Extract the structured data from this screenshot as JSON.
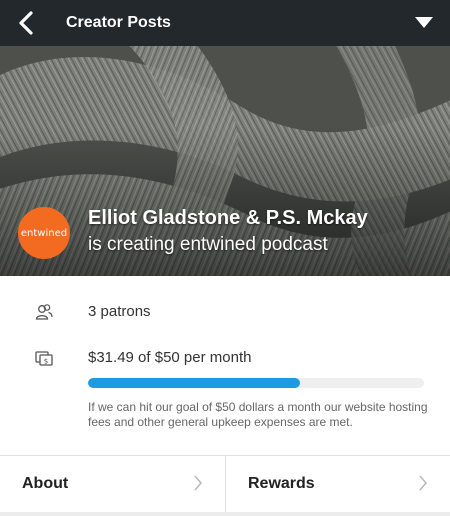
{
  "header": {
    "title": "Creator Posts",
    "back_icon": "chevron-left-icon",
    "menu_icon": "caret-down-icon"
  },
  "creator": {
    "logo_text": "entwined",
    "name": "Elliot Gladstone & P.S. Mckay",
    "subtitle": "is creating entwined podcast"
  },
  "stats": {
    "patrons_text": "3 patrons",
    "goal_text": "$31.49 of $50 per month",
    "goal_progress_fraction": 0.63,
    "goal_description": "If we can hit our goal of $50 dollars a month our website hosting fees and other general upkeep expenses are met."
  },
  "tabs": [
    {
      "label": "About"
    },
    {
      "label": "Rewards"
    }
  ],
  "colors": {
    "header_bg": "#23282d",
    "logo_orange": "#f26b21",
    "progress_blue": "#1d9be0"
  }
}
